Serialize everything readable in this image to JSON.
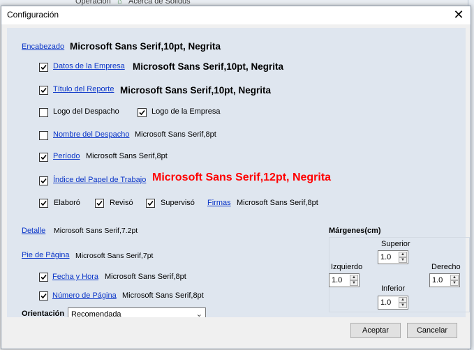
{
  "background": {
    "menu_item_1": "Operación",
    "menu_item_2": "Acerca de Solidus"
  },
  "dialog": {
    "title": "Configuración"
  },
  "encabezado": {
    "label": "Encabezado",
    "font": "Microsoft Sans Serif,10pt, Negrita"
  },
  "datos_empresa": {
    "label": "Datos de la Empresa",
    "font": "Microsoft Sans Serif,10pt, Negrita",
    "checked": true
  },
  "titulo_reporte": {
    "label": "Título del Reporte",
    "font": "Microsoft Sans Serif,10pt, Negrita",
    "checked": true
  },
  "logo_despacho": {
    "label": "Logo del Despacho",
    "checked": false
  },
  "logo_empresa": {
    "label": "Logo de la Empresa",
    "checked": true
  },
  "nombre_despacho": {
    "label": "Nombre del Despacho",
    "font": "Microsoft Sans Serif,8pt",
    "checked": false
  },
  "periodo": {
    "label": "Período",
    "font": "Microsoft Sans Serif,8pt",
    "checked": true
  },
  "indice": {
    "label": "Índice del Papel de Trabajo",
    "font": "Microsoft Sans Serif,12pt, Negrita",
    "checked": true,
    "color": "#ff0000"
  },
  "firmas": {
    "elaboro": {
      "label": "Elaboró",
      "checked": true
    },
    "reviso": {
      "label": "Revisó",
      "checked": true
    },
    "superviso": {
      "label": "Supervisó",
      "checked": true
    },
    "label": "Firmas",
    "font": "Microsoft Sans Serif,8pt"
  },
  "detalle": {
    "label": "Detalle",
    "font": "Microsoft Sans Serif,7.2pt"
  },
  "pie": {
    "label": "Pie de Página",
    "font": "Microsoft Sans Serif,7pt"
  },
  "fecha_hora": {
    "label": "Fecha y Hora",
    "font": "Microsoft Sans Serif,8pt",
    "checked": true
  },
  "numero_pagina": {
    "label": "Número de Página",
    "font": "Microsoft Sans Serif,8pt",
    "checked": true
  },
  "orientacion": {
    "label": "Orientación",
    "value": "Recomendada"
  },
  "margenes": {
    "title": "Márgenes(cm)",
    "superior": {
      "label": "Superior",
      "value": "1.0"
    },
    "izquierdo": {
      "label": "Izquierdo",
      "value": "1.0"
    },
    "derecho": {
      "label": "Derecho",
      "value": "1.0"
    },
    "inferior": {
      "label": "Inferior",
      "value": "1.0"
    }
  },
  "buttons": {
    "accept": "Aceptar",
    "cancel": "Cancelar"
  },
  "colors": {
    "link": "#0b36c8",
    "content_bg": "#dfe6ef",
    "warning_text": "#ff0000"
  }
}
